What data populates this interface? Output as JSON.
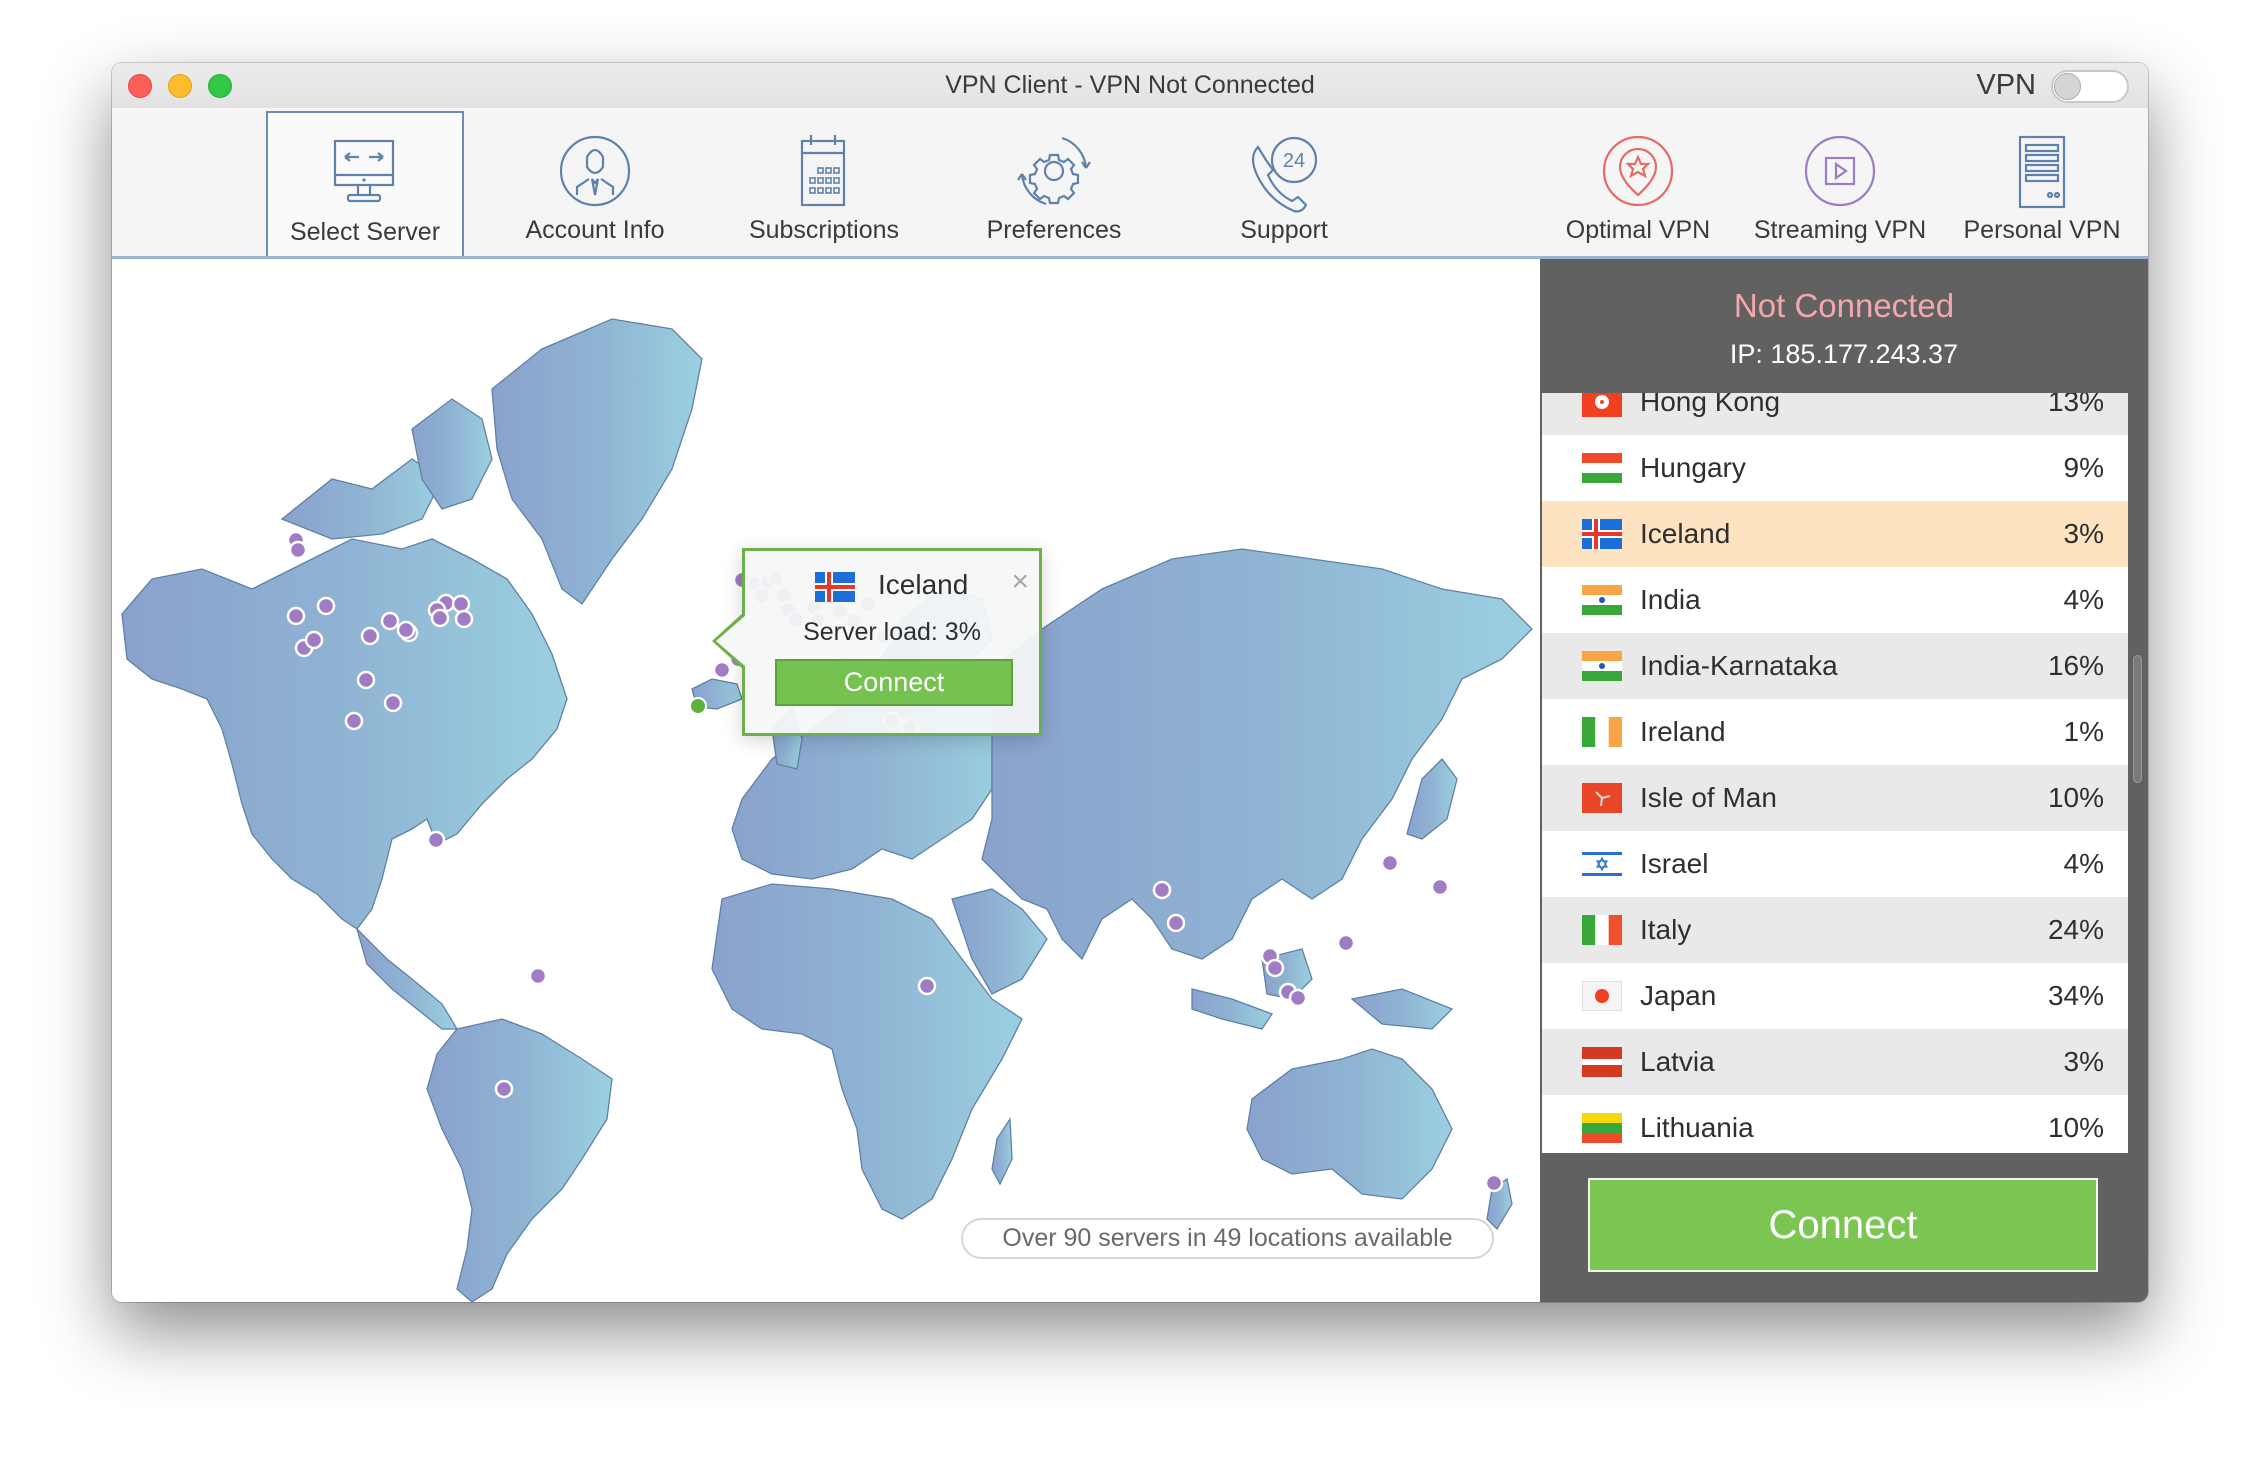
{
  "window": {
    "title": "VPN Client - VPN Not Connected",
    "vpn_toggle_label": "VPN",
    "vpn_toggle_on": false
  },
  "toolbar": {
    "tabs": [
      {
        "label": "Select Server",
        "icon": "monitor-arrows-icon",
        "active": true
      },
      {
        "label": "Account Info",
        "icon": "user-circle-icon",
        "active": false
      },
      {
        "label": "Subscriptions",
        "icon": "calendar-icon",
        "active": false
      },
      {
        "label": "Preferences",
        "icon": "gear-refresh-icon",
        "active": false
      },
      {
        "label": "Support",
        "icon": "phone-24-icon",
        "active": false
      },
      {
        "label": "Optimal VPN",
        "icon": "location-star-icon",
        "active": false
      },
      {
        "label": "Streaming VPN",
        "icon": "play-circle-icon",
        "active": false
      },
      {
        "label": "Personal VPN",
        "icon": "server-icon",
        "active": false
      }
    ]
  },
  "map": {
    "popup": {
      "country": "Iceland",
      "server_load": "Server load: 3%",
      "connect_label": "Connect",
      "close_glyph": "×"
    },
    "servers_summary": "Over 90 servers in 49 locations available"
  },
  "sidebar": {
    "status": "Not Connected",
    "ip": "IP: 185.177.243.37",
    "colors": {
      "status_text": "#f3a7ad",
      "selected_row": "#fde3c0",
      "connect_green": "#7bc553"
    },
    "servers": [
      {
        "country": "Hong Kong",
        "load": "13%",
        "flag": "hk"
      },
      {
        "country": "Hungary",
        "load": "9%",
        "flag": "hu"
      },
      {
        "country": "Iceland",
        "load": "3%",
        "flag": "is",
        "selected": true
      },
      {
        "country": "India",
        "load": "4%",
        "flag": "in"
      },
      {
        "country": "India-Karnataka",
        "load": "16%",
        "flag": "in"
      },
      {
        "country": "Ireland",
        "load": "1%",
        "flag": "ie"
      },
      {
        "country": "Isle of Man",
        "load": "10%",
        "flag": "im"
      },
      {
        "country": "Israel",
        "load": "4%",
        "flag": "il"
      },
      {
        "country": "Italy",
        "load": "24%",
        "flag": "it"
      },
      {
        "country": "Japan",
        "load": "34%",
        "flag": "jp"
      },
      {
        "country": "Latvia",
        "load": "3%",
        "flag": "lv"
      },
      {
        "country": "Lithuania",
        "load": "10%",
        "flag": "lt"
      }
    ],
    "connect_label": "Connect"
  }
}
